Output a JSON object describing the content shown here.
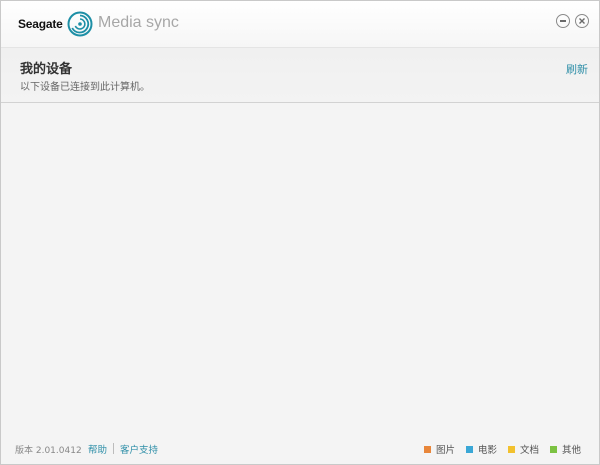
{
  "header": {
    "brand": "Seagate",
    "app_title": "Media sync"
  },
  "section": {
    "title": "我的设备",
    "subtitle": "以下设备已连接到此计算机。",
    "refresh_label": "刷新"
  },
  "footer": {
    "version": "版本 2.01.0412",
    "help_label": "帮助",
    "support_label": "客户支持",
    "legend": [
      {
        "label": "图片",
        "color": "#e8863a"
      },
      {
        "label": "电影",
        "color": "#3aa7d6"
      },
      {
        "label": "文档",
        "color": "#f2c12e"
      },
      {
        "label": "其他",
        "color": "#7cc242"
      }
    ]
  },
  "colors": {
    "accent": "#2f8fa8",
    "logo": "#1d8fa6"
  },
  "icons": {
    "logo": "seagate-swirl-icon",
    "minimize": "minimize-icon",
    "close": "close-icon"
  }
}
